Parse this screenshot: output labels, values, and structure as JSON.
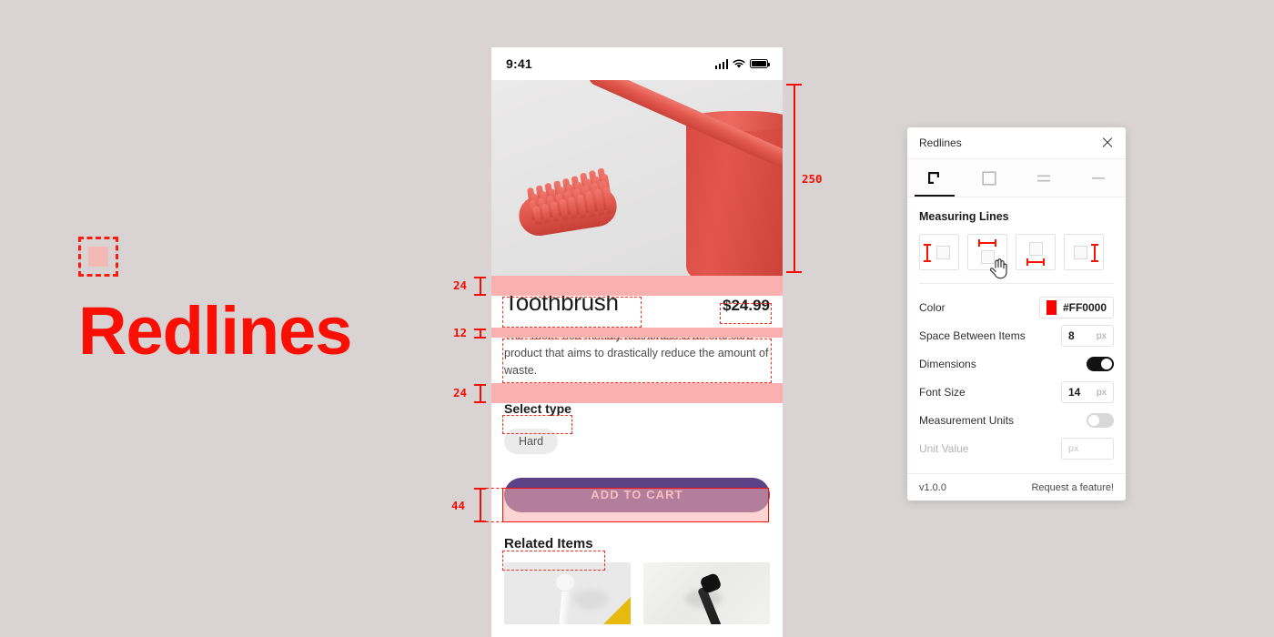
{
  "brand": {
    "title": "Redlines",
    "logo_icon": "dashed-square-icon",
    "accent": "#FA0F04"
  },
  "phone": {
    "status_bar": {
      "time": "9:41",
      "signal_icon": "cellular-signal-icon",
      "wifi_icon": "wifi-icon",
      "battery_icon": "battery-full-icon"
    },
    "product": {
      "title": "Toothbrush",
      "price": "$24.99",
      "description": "The ‘Tooth’ eco-friendly toothbrush is an oral care product that aims to drastically reduce the amount of waste.",
      "select_label": "Select type",
      "chip": "Hard",
      "cta": "ADD TO CART",
      "related_title": "Related Items",
      "related": [
        {
          "name": "white-toothbrush-thumbnail"
        },
        {
          "name": "black-toothbrush-thumbnail"
        }
      ]
    }
  },
  "redlines": {
    "hero_height": "250",
    "spacing_image_to_title": "24",
    "spacing_title_to_desc": "12",
    "spacing_desc_to_select": "24",
    "cta_height": "44"
  },
  "panel": {
    "title": "Redlines",
    "close_icon": "close-icon",
    "tabs": [
      {
        "name": "measuring-lines",
        "icon": "corner-measure-icon",
        "active": true
      },
      {
        "name": "boxes",
        "icon": "square-outline-icon",
        "active": false
      },
      {
        "name": "spacing",
        "icon": "double-line-icon",
        "active": false
      },
      {
        "name": "single-line",
        "icon": "single-line-icon",
        "active": false
      }
    ],
    "section_title": "Measuring Lines",
    "options": [
      {
        "name": "measure-left",
        "icon": "measure-left-icon"
      },
      {
        "name": "measure-top",
        "icon": "measure-top-icon"
      },
      {
        "name": "measure-bottom",
        "icon": "measure-bottom-icon"
      },
      {
        "name": "measure-right",
        "icon": "measure-right-icon"
      }
    ],
    "settings": {
      "color_label": "Color",
      "color_value": "#FF0000",
      "space_label": "Space Between Items",
      "space_value": "8",
      "space_unit": "px",
      "dimensions_label": "Dimensions",
      "dimensions_on": true,
      "font_size_label": "Font Size",
      "font_size_value": "14",
      "font_size_unit": "px",
      "units_label": "Measurement Units",
      "units_on": false,
      "unit_value_label": "Unit Value",
      "unit_value_placeholder": "px"
    },
    "footer": {
      "version": "v1.0.0",
      "request": "Request a feature!"
    }
  }
}
